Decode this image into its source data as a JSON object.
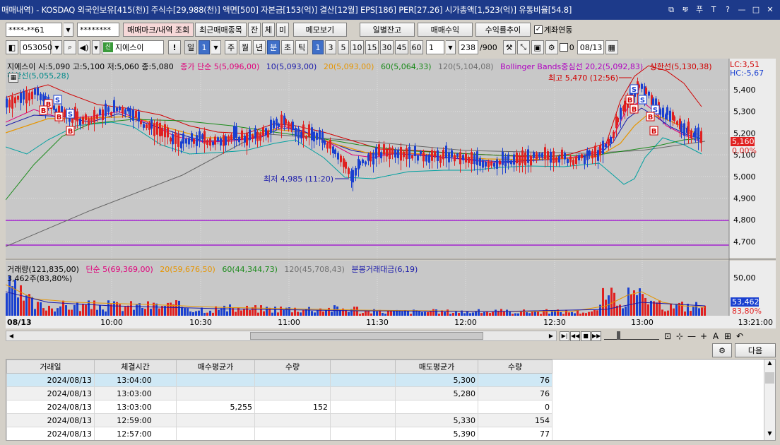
{
  "window": {
    "title": "매매내역) - KOSDAQ 외국인보유[415(천)] 주식수[29,988(천)] 액면[500] 자본금[153(억)] 결산[12월] EPS[186] PER[27.26] 시가총액[1,523(억)] 유통비율[54.8]",
    "buttons": [
      "⧉",
      "ቹ",
      "푸",
      "T",
      "?",
      "—",
      "□",
      "✕"
    ]
  },
  "toolbar1": {
    "account": "****-**61",
    "password": "********",
    "trade_mark_btn": "매매마크/내역 조회",
    "recent_stocks_btn": "최근매매종목",
    "tab_balance": "잔",
    "tab_fill": "체",
    "tab_unfilled": "미",
    "memo_btn": "메모보기",
    "daily_balance_btn": "일별잔고",
    "trade_profit_btn": "매매수익",
    "return_trend_btn": "수익률추이",
    "account_link_label": "계좌연동",
    "account_link_checked": "✓"
  },
  "toolbar2": {
    "code": "053050",
    "stock_name": "지에스이",
    "credit_badge": "신",
    "warn_btn": "!",
    "period_day": "일",
    "period_day_n": "1",
    "period_week": "주",
    "period_month": "월",
    "period_year": "년",
    "period_min": "분",
    "period_sec": "초",
    "period_tick": "틱",
    "intervals": [
      "1",
      "3",
      "5",
      "10",
      "15",
      "30",
      "45",
      "60"
    ],
    "interval_value": "1",
    "count": "238",
    "count_max": "/900",
    "zero_checkbox_label": "0",
    "date": "08/13"
  },
  "chart": {
    "price_legend": [
      {
        "text": "지에스이 시:5,090 고:5,100 저:5,060 종:5,080",
        "color": "#000000"
      },
      {
        "text": "종가 단순 5(5,096,00)",
        "color": "#e0007a"
      },
      {
        "text": "10(5,093,00)",
        "color": "#1a1aaa"
      },
      {
        "text": "20(5,093,00)",
        "color": "#e69500"
      },
      {
        "text": "60(5,064,33)",
        "color": "#1a8a1a"
      },
      {
        "text": "120(5,104,08)",
        "color": "#707070"
      },
      {
        "text": "Bollinger Bands중심선 20,2(5,092,83)",
        "color": "#b000c0"
      },
      {
        "text": "상한선(5,130,38)",
        "color": "#d00000"
      }
    ],
    "lower_band_label": "하한선(5,055,28)",
    "lc_label": "LC:3,51",
    "hc_label": "HC:-5,67",
    "high_annot": "최고 5,470 (12:56)",
    "low_annot": "최저 4,985 (11:20)",
    "price_axis": [
      "5,400",
      "5,300",
      "5,200",
      "5,100",
      "5,000",
      "4,900",
      "4,800",
      "4,700"
    ],
    "current_price": "5,160",
    "current_pct": "0,00%",
    "volume_legend": [
      {
        "text": "거래량(121,835,00)",
        "color": "#000000"
      },
      {
        "text": "단순 5(69,369,00)",
        "color": "#e0007a"
      },
      {
        "text": "20(59,676,50)",
        "color": "#e69500"
      },
      {
        "text": "60(44,344,73)",
        "color": "#1a8a1a"
      },
      {
        "text": "120(45,708,43)",
        "color": "#707070"
      },
      {
        "text": "분봉거래대금(6,19)",
        "color": "#1a1aaa"
      }
    ],
    "volume_sub": "3,462주(83,80%)",
    "volume_axis": [
      "50,00"
    ],
    "volume_current": "53,462",
    "volume_pct": "83,80%",
    "time_axis": [
      "08/13",
      "10:00",
      "10:30",
      "11:00",
      "11:30",
      "12:00",
      "12:30",
      "13:00"
    ],
    "time_now": "13:21:00",
    "colors": {
      "up": "#e02020",
      "down": "#1a40d0",
      "bg": "#c8c8c8"
    }
  },
  "nav": {
    "controls": [
      "▶|",
      "◀◀",
      "■",
      "▶▶"
    ],
    "tools": [
      "—",
      "+",
      "A",
      "⊞",
      "↶"
    ]
  },
  "grid": {
    "gear": "⚙",
    "next_btn": "다음",
    "headers": [
      "거래일",
      "체결시간",
      "매수평균가",
      "수량",
      "",
      "매도평균가",
      "수량"
    ],
    "rows": [
      [
        "2024/08/13",
        "13:04:00",
        "",
        "",
        "",
        "5,300",
        "76"
      ],
      [
        "2024/08/13",
        "13:03:00",
        "",
        "",
        "",
        "5,280",
        "76"
      ],
      [
        "2024/08/13",
        "13:03:00",
        "5,255",
        "152",
        "",
        "",
        "0"
      ],
      [
        "2024/08/13",
        "12:59:00",
        "",
        "",
        "",
        "5,330",
        "154"
      ],
      [
        "2024/08/13",
        "12:57:00",
        "",
        "",
        "",
        "5,390",
        "77"
      ]
    ]
  }
}
